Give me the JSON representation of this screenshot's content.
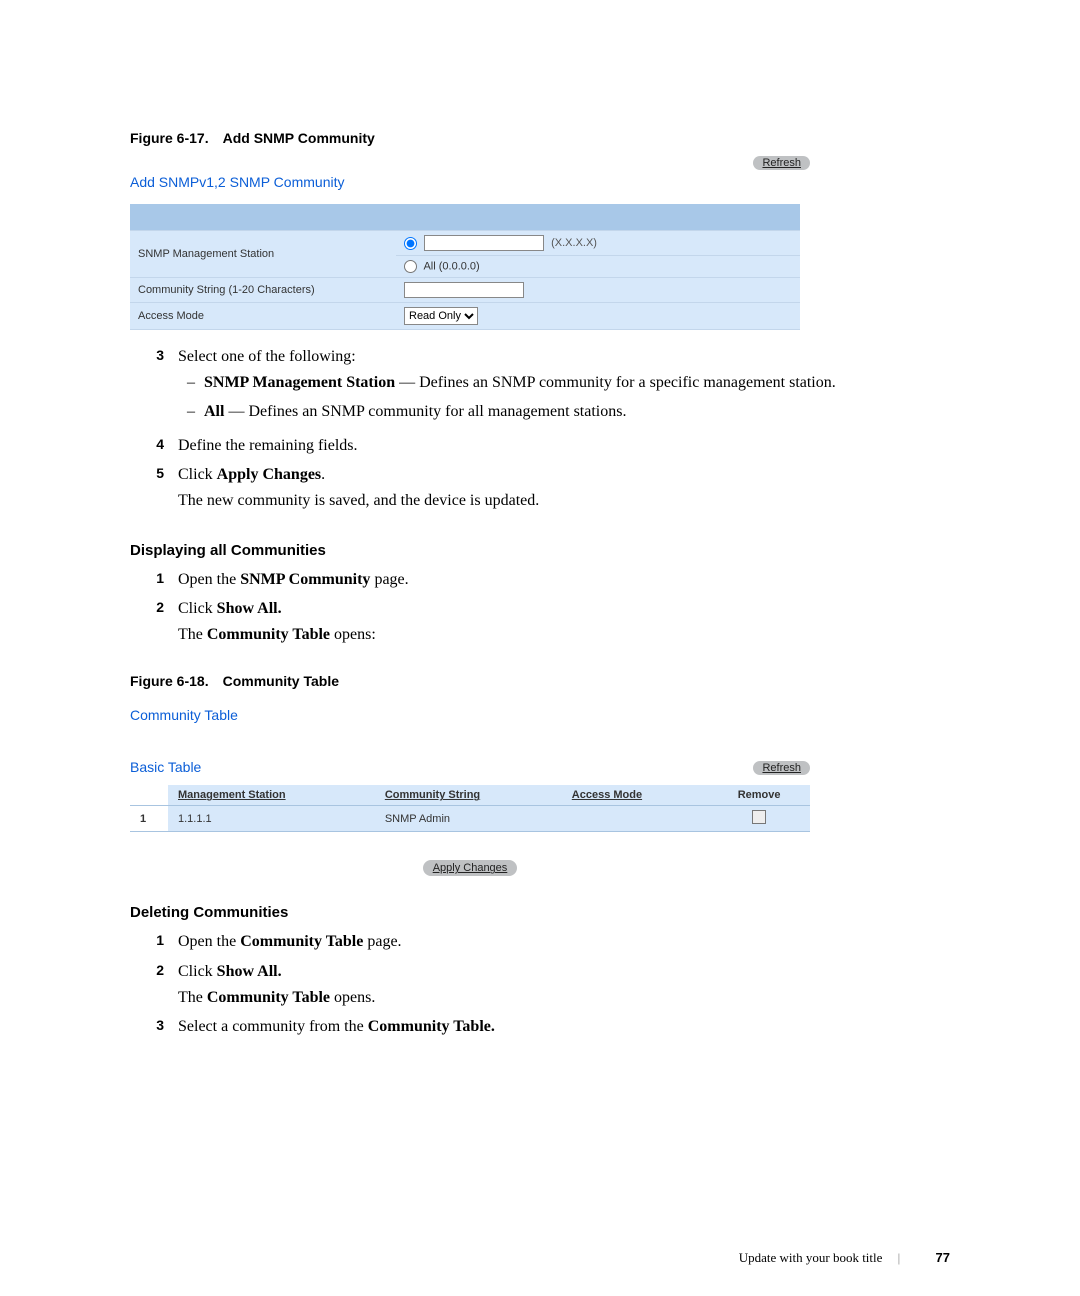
{
  "figure1": {
    "caption_prefix": "Figure 6-17.",
    "caption_title": "Add SNMP Community",
    "refresh_label": "Refresh",
    "page_title": "Add SNMPv1,2 SNMP Community",
    "rows": {
      "mgmt_label": "SNMP Management Station",
      "mgmt_hint": "(X.X.X.X)",
      "mgmt_all": "All (0.0.0.0)",
      "community_label": "Community String (1-20 Characters)",
      "access_label": "Access Mode",
      "access_value": "Read Only"
    }
  },
  "step3": {
    "num": "3",
    "intro": "Select one of the following:",
    "sub1_b": "SNMP Management Station",
    "sub1_rest": " — Defines an SNMP community for a specific management station.",
    "sub2_b": "All",
    "sub2_rest": " — Defines an SNMP community for all management stations."
  },
  "step4": {
    "num": "4",
    "text": "Define the remaining fields."
  },
  "step5": {
    "num": "5",
    "pre": "Click ",
    "b": "Apply Changes",
    "post": ".",
    "line2": "The new community is saved, and the device is updated."
  },
  "sectionA": {
    "title": "Displaying all Communities",
    "s1": {
      "num": "1",
      "pre": "Open the ",
      "b": "SNMP Community",
      "post": " page."
    },
    "s2": {
      "num": "2",
      "pre": "Click ",
      "b": "Show All."
    },
    "s2_line2_pre": "The ",
    "s2_line2_b": "Community Table",
    "s2_line2_post": " opens:"
  },
  "figure2": {
    "caption_prefix": "Figure 6-18.",
    "caption_title": "Community Table",
    "title1": "Community Table",
    "refresh_label": "Refresh",
    "title2": "Basic Table",
    "headers": {
      "mgmt": "Management Station",
      "cs": "Community String",
      "am": "Access Mode",
      "rm": "Remove"
    },
    "row": {
      "idx": "1",
      "mgmt": "1.1.1.1",
      "cs": "SNMP Admin",
      "am": "",
      "rm": ""
    },
    "apply": "Apply Changes"
  },
  "sectionB": {
    "title": "Deleting Communities",
    "s1": {
      "num": "1",
      "pre": "Open the ",
      "b": "Community Table",
      "post": " page."
    },
    "s2": {
      "num": "2",
      "pre": "Click ",
      "b": "Show All."
    },
    "s2_line2_pre": "The ",
    "s2_line2_b": "Community Table",
    "s2_line2_post": " opens.",
    "s3": {
      "num": "3",
      "pre": "Select a community from the ",
      "b": "Community Table."
    }
  },
  "footer": {
    "book": "Update with your book title",
    "page": "77"
  }
}
